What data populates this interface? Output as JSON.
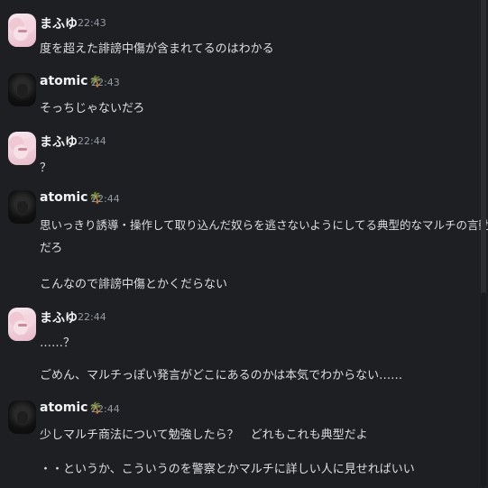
{
  "messages": [
    {
      "author": "まふゆ",
      "time": "22:43",
      "lines": [
        "度を超えた誹謗中傷が含まれてるのはわかる"
      ]
    },
    {
      "author": "atomic",
      "palm": "🌴",
      "time": "22:43",
      "lines": [
        "そっちじゃないだろ"
      ]
    },
    {
      "author": "まふゆ",
      "time": "22:44",
      "lines": [
        "？"
      ]
    },
    {
      "author": "atomic",
      "palm": "🌴",
      "time": "22:44",
      "lines": [
        "思いっきり誘導・操作して取り込んだ奴らを逃さないようにしてる典型的なマルチの言動",
        "だろ",
        "こんなので誹謗中傷とかくだらない"
      ]
    },
    {
      "author": "まふゆ",
      "time": "22:44",
      "lines": [
        "……？",
        "ごめん、マルチっぽい発言がどこにあるのかは本気でわからない……"
      ]
    },
    {
      "author": "atomic",
      "palm": "🌴",
      "time": "22:44",
      "lines": [
        "少しマルチ商法について勉強したら？　どれもこれも典型だよ",
        "・・というか、こういうのを警察とかマルチに詳しい人に見せればいい"
      ]
    }
  ]
}
